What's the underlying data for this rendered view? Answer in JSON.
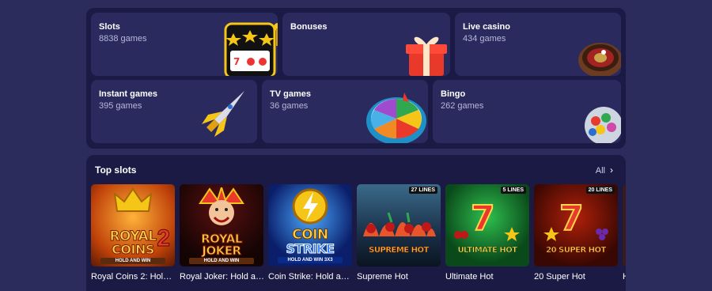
{
  "categories": {
    "slots": {
      "title": "Slots",
      "subtitle": "8838 games"
    },
    "bonuses": {
      "title": "Bonuses"
    },
    "live_casino": {
      "title": "Live casino",
      "subtitle": "434 games"
    },
    "instant": {
      "title": "Instant games",
      "subtitle": "395 games"
    },
    "tv": {
      "title": "TV games",
      "subtitle": "36 games"
    },
    "bingo": {
      "title": "Bingo",
      "subtitle": "262 games"
    }
  },
  "top_slots": {
    "title": "Top slots",
    "all_label": "All",
    "games": [
      {
        "name": "Royal Coins 2: Hold a...",
        "art_line1": "ROYAL",
        "art_line2": "COINS",
        "art_num": "2",
        "art_tag": "HOLD AND WIN"
      },
      {
        "name": "Royal Joker: Hold and...",
        "art_line1": "ROYAL",
        "art_line2": "JOKER",
        "art_tag": "HOLD AND WIN"
      },
      {
        "name": "Coin Strike: Hold and ...",
        "art_line1": "COIN",
        "art_line2": "STRIKE",
        "art_tag": "HOLD AND WIN 3X3"
      },
      {
        "name": "Supreme Hot",
        "art_line1": "SUPREME HOT",
        "badge": "27 LINES"
      },
      {
        "name": "Ultimate Hot",
        "art_num": "7",
        "art_line1": "ULTIMATE HOT",
        "badge": "5 LINES"
      },
      {
        "name": "20 Super Hot",
        "art_num": "7",
        "art_line1": "20 SUPER HOT",
        "badge": "20 LINES"
      },
      {
        "name": "H"
      }
    ]
  },
  "colors": {
    "page_bg": "#2b2b5c",
    "panel_bg": "#1a1a44",
    "tile_bg": "#2a2a5e",
    "subtitle": "#b8b8d8"
  },
  "icons": [
    "slot-machine-icon",
    "gift-box-icon",
    "roulette-icon",
    "rocket-icon",
    "fortune-wheel-icon",
    "bingo-balls-icon",
    "chevron-right-icon"
  ]
}
